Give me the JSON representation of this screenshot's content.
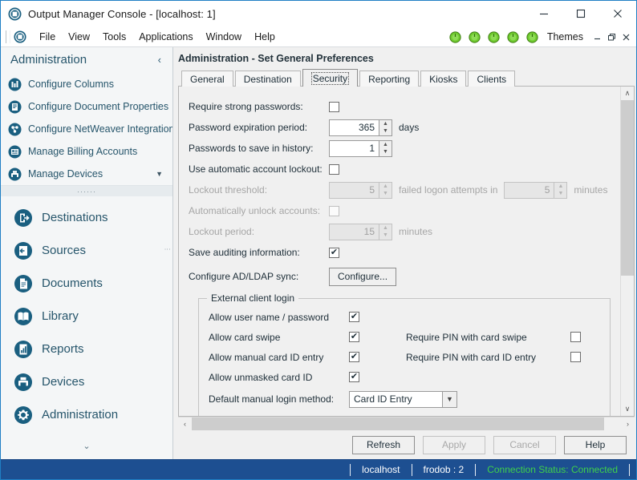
{
  "window": {
    "title": "Output Manager Console - [localhost: 1]",
    "app_icon": "app-circle-icon",
    "minimize": "—",
    "maximize": "☐",
    "close": "✕"
  },
  "menubar": {
    "icon": "app-circle-icon",
    "items": [
      {
        "label": "File"
      },
      {
        "label": "View"
      },
      {
        "label": "Tools"
      },
      {
        "label": "Applications"
      },
      {
        "label": "Window"
      },
      {
        "label": "Help"
      }
    ],
    "status_leds": 5,
    "themes_label": "Themes",
    "mini_minimize": "–",
    "mini_restore": "❐",
    "mini_close": "✕"
  },
  "sidebar": {
    "title": "Administration",
    "collapse_icon": "‹",
    "sub_items": [
      {
        "label": "Configure Columns",
        "icon": "columns-icon"
      },
      {
        "label": "Configure Document Properties",
        "icon": "document-properties-icon"
      },
      {
        "label": "Configure NetWeaver Integration",
        "icon": "netweaver-icon"
      },
      {
        "label": "Manage Billing Accounts",
        "icon": "billing-icon"
      },
      {
        "label": "Manage Devices",
        "icon": "devices-small-icon",
        "has_caret": true
      }
    ],
    "dots": "······",
    "main_items": [
      {
        "label": "Destinations",
        "icon": "destinations-icon"
      },
      {
        "label": "Sources",
        "icon": "sources-icon"
      },
      {
        "label": "Documents",
        "icon": "documents-icon"
      },
      {
        "label": "Library",
        "icon": "library-icon"
      },
      {
        "label": "Reports",
        "icon": "reports-icon"
      },
      {
        "label": "Devices",
        "icon": "devices-icon"
      },
      {
        "label": "Administration",
        "icon": "administration-gear-icon"
      }
    ],
    "expand_down_icon": "⌄"
  },
  "main": {
    "title": "Administration - Set General Preferences",
    "tabs": [
      {
        "label": "General",
        "active": false
      },
      {
        "label": "Destination",
        "active": false
      },
      {
        "label": "Security",
        "active": true
      },
      {
        "label": "Reporting",
        "active": false
      },
      {
        "label": "Kiosks",
        "active": false
      },
      {
        "label": "Clients",
        "active": false
      }
    ],
    "security": {
      "require_strong_passwords": {
        "label": "Require strong passwords:",
        "checked": false,
        "enabled": true
      },
      "password_expiration": {
        "label": "Password expiration period:",
        "value": "365",
        "unit": "days",
        "enabled": true
      },
      "passwords_history": {
        "label": "Passwords to save in history:",
        "value": "1",
        "unit": "",
        "enabled": true
      },
      "use_automatic_lockout": {
        "label": "Use automatic account lockout:",
        "checked": false,
        "enabled": true
      },
      "lockout_threshold": {
        "label": "Lockout threshold:",
        "value": "5",
        "middle_text": "failed logon attempts in",
        "value2": "5",
        "unit": "minutes",
        "enabled": false
      },
      "auto_unlock": {
        "label": "Automatically unlock accounts:",
        "checked": false,
        "enabled": false
      },
      "lockout_period": {
        "label": "Lockout period:",
        "value": "15",
        "unit": "minutes",
        "enabled": false
      },
      "save_auditing": {
        "label": "Save auditing information:",
        "checked": true,
        "enabled": true
      },
      "configure_ad_ldap": {
        "label": "Configure AD/LDAP sync:",
        "button": "Configure..."
      },
      "external_client_login": {
        "legend": "External client login",
        "rows": [
          {
            "label": "Allow user name / password",
            "checked": true,
            "right_label": "",
            "right_checked": null
          },
          {
            "label": "Allow card swipe",
            "checked": true,
            "right_label": "Require PIN with card swipe",
            "right_checked": false
          },
          {
            "label": "Allow manual card ID entry",
            "checked": true,
            "right_label": "Require  PIN with card ID entry",
            "right_checked": false
          },
          {
            "label": "Allow unmasked card ID",
            "checked": true,
            "right_label": "",
            "right_checked": null
          }
        ],
        "default_login": {
          "label": "Default manual login method:",
          "value": "Card ID Entry",
          "arrow": "⌄"
        }
      }
    },
    "buttons": [
      {
        "label": "Refresh",
        "enabled": true
      },
      {
        "label": "Apply",
        "enabled": false
      },
      {
        "label": "Cancel",
        "enabled": false
      },
      {
        "label": "Help",
        "enabled": true
      }
    ],
    "scroll": {
      "up_arrow": "∧",
      "down_arrow": "∨",
      "left_arrow": "‹",
      "right_arrow": "›"
    }
  },
  "statusbar": {
    "host": "localhost",
    "user": "frodob : 2",
    "connection": "Connection Status: Connected",
    "connection_color": "#3fd14a",
    "background": "#1d4f91"
  }
}
